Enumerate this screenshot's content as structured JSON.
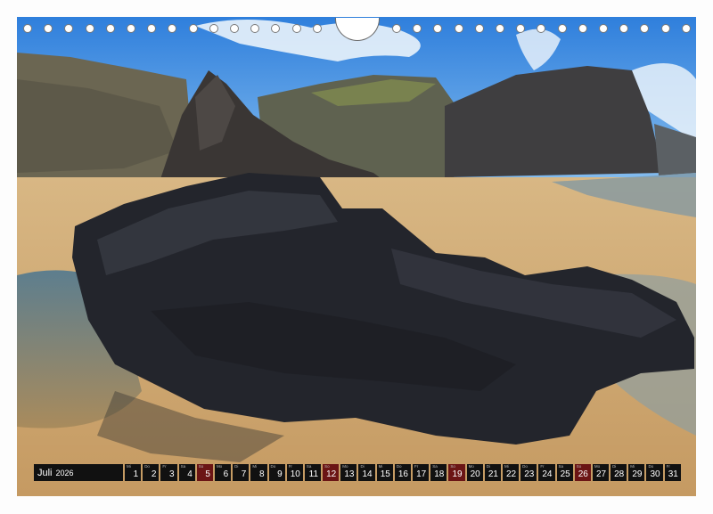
{
  "calendar": {
    "month": "Juli",
    "year": "2026",
    "days": [
      {
        "wd": "Mi",
        "num": "1",
        "sunday": false
      },
      {
        "wd": "Do",
        "num": "2",
        "sunday": false
      },
      {
        "wd": "Fr",
        "num": "3",
        "sunday": false
      },
      {
        "wd": "Sa",
        "num": "4",
        "sunday": false
      },
      {
        "wd": "So",
        "num": "5",
        "sunday": true
      },
      {
        "wd": "Mo",
        "num": "6",
        "sunday": false
      },
      {
        "wd": "Di",
        "num": "7",
        "sunday": false
      },
      {
        "wd": "Mi",
        "num": "8",
        "sunday": false
      },
      {
        "wd": "Do",
        "num": "9",
        "sunday": false
      },
      {
        "wd": "Fr",
        "num": "10",
        "sunday": false
      },
      {
        "wd": "Sa",
        "num": "11",
        "sunday": false
      },
      {
        "wd": "So",
        "num": "12",
        "sunday": true
      },
      {
        "wd": "Mo",
        "num": "13",
        "sunday": false
      },
      {
        "wd": "Di",
        "num": "14",
        "sunday": false
      },
      {
        "wd": "Mi",
        "num": "15",
        "sunday": false
      },
      {
        "wd": "Do",
        "num": "16",
        "sunday": false
      },
      {
        "wd": "Fr",
        "num": "17",
        "sunday": false
      },
      {
        "wd": "Sa",
        "num": "18",
        "sunday": false
      },
      {
        "wd": "So",
        "num": "19",
        "sunday": true
      },
      {
        "wd": "Mo",
        "num": "20",
        "sunday": false
      },
      {
        "wd": "Di",
        "num": "21",
        "sunday": false
      },
      {
        "wd": "Mi",
        "num": "22",
        "sunday": false
      },
      {
        "wd": "Do",
        "num": "23",
        "sunday": false
      },
      {
        "wd": "Fr",
        "num": "24",
        "sunday": false
      },
      {
        "wd": "Sa",
        "num": "25",
        "sunday": false
      },
      {
        "wd": "So",
        "num": "26",
        "sunday": true
      },
      {
        "wd": "Mo",
        "num": "27",
        "sunday": false
      },
      {
        "wd": "Di",
        "num": "28",
        "sunday": false
      },
      {
        "wd": "Mi",
        "num": "29",
        "sunday": false
      },
      {
        "wd": "Do",
        "num": "30",
        "sunday": false
      },
      {
        "wd": "Fr",
        "num": "31",
        "sunday": false
      }
    ]
  },
  "colors": {
    "sky": "#3f8fe0",
    "sand": "#d9b07a",
    "rock": "#2a2c33",
    "sunday": "#6b1515"
  }
}
